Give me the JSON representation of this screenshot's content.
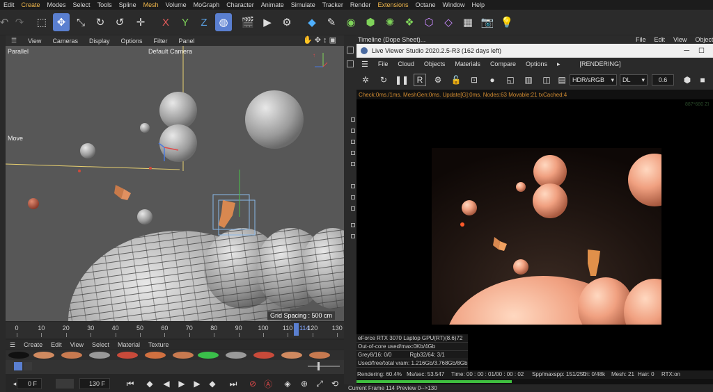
{
  "menubar": {
    "items": [
      {
        "label": "Edit",
        "accent": false
      },
      {
        "label": "Create",
        "accent": true
      },
      {
        "label": "Modes",
        "accent": false
      },
      {
        "label": "Select",
        "accent": false
      },
      {
        "label": "Tools",
        "accent": false
      },
      {
        "label": "Spline",
        "accent": false
      },
      {
        "label": "Mesh",
        "accent": true
      },
      {
        "label": "Volume",
        "accent": false
      },
      {
        "label": "MoGraph",
        "accent": false
      },
      {
        "label": "Character",
        "accent": false
      },
      {
        "label": "Animate",
        "accent": false
      },
      {
        "label": "Simulate",
        "accent": false
      },
      {
        "label": "Tracker",
        "accent": false
      },
      {
        "label": "Render",
        "accent": false
      },
      {
        "label": "Extensions",
        "accent": true
      },
      {
        "label": "Octane",
        "accent": false
      },
      {
        "label": "Window",
        "accent": false
      },
      {
        "label": "Help",
        "accent": false
      }
    ]
  },
  "toolbar": {
    "axis_x": "X",
    "axis_y": "Y",
    "axis_z": "Z"
  },
  "viewport": {
    "menu": [
      "View",
      "Cameras",
      "Display",
      "Options",
      "Filter",
      "Panel"
    ],
    "projection": "Parallel",
    "camera": "Default Camera",
    "tool": "Move",
    "grid_spacing": "Grid Spacing : 500 cm"
  },
  "timeline": {
    "ticks": [
      "0",
      "10",
      "20",
      "30",
      "40",
      "50",
      "60",
      "70",
      "80",
      "90",
      "100",
      "110",
      "120",
      "130"
    ],
    "current_marker": "114",
    "start_field": "0 F",
    "end_field": "130 F"
  },
  "material_menu": [
    "Create",
    "Edit",
    "View",
    "Select",
    "Material",
    "Texture"
  ],
  "right_header": {
    "timeline_title": "Timeline (Dope Sheet)...",
    "menu": [
      "File",
      "Edit",
      "View",
      "Object"
    ]
  },
  "live_viewer": {
    "title": "Live Viewer Studio 2020.2.5-R3 (162 days left)",
    "menu": [
      "File",
      "Cloud",
      "Objects",
      "Materials",
      "Compare",
      "Options"
    ],
    "rendering_flag": "[RENDERING]",
    "colorspace": "HDR/sRGB",
    "mode": "DL",
    "exposure": "0.6",
    "status_line": "Check:0ms./1ms. MeshGen:0ms. Update[G]:0ms. Nodes:63 Movable:21 txCached:4",
    "resolution": "887*680 ZI",
    "gpu": {
      "name": "eForce RTX 3070 Laptop GPU(RT)(8.6)72",
      "out_of_core": "Out-of-core used/max:0Kb/4Gb",
      "grey_label": "Grey8/16: 0/0",
      "rgb_label": "Rgb32/64: 3/1",
      "vram": "Used/free/total vram: 1.216Gb/3.768Gb/8Gb"
    },
    "stats": {
      "rendering": "Rendering: 60.4%",
      "ms_sec": "Ms/sec: 53.547",
      "time": "Time: 00 : 00 : 01/00 : 00 : 02",
      "spp": "Spp/maxspp: 151/250",
      "tri": "Tri: 0/48k",
      "mesh": "Mesh: 21",
      "hair": "Hair: 0",
      "rtx": "RTX:on"
    },
    "progress": 0.604
  },
  "footer": {
    "current_frame": "Current Frame  114  Preview  0-->130"
  },
  "colors": {
    "accent_menu": "#f2b84b",
    "selected_tool": "#5a7fd0",
    "status_orange": "#d08a30",
    "progress_green": "#3fbf3f"
  }
}
